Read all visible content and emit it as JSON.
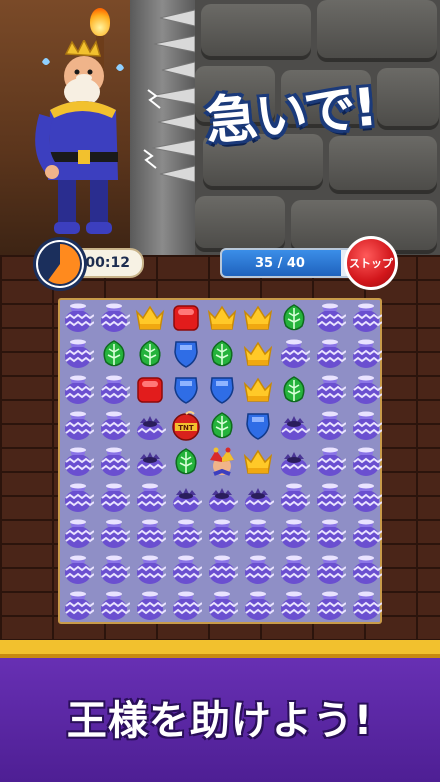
{
  "scene": {
    "headline": "急いで!"
  },
  "hud": {
    "timer": "00:12",
    "timer_fraction_remaining": 0.6,
    "progress_text": "35 / 40",
    "progress_current": 35,
    "progress_total": 40,
    "stop_label": "ストップ"
  },
  "board": {
    "cols": 9,
    "rows": 9,
    "legend": {
      "P": "purple-pot",
      "C": "gold-crown",
      "R": "red-gem",
      "L": "green-leaf",
      "S": "blue-shield",
      "B": "broken-pot",
      "T": "tnt-booster",
      "K": "jester-booster"
    },
    "grid": [
      [
        "P",
        "P",
        "C",
        "R",
        "C",
        "C",
        "L",
        "P",
        "P"
      ],
      [
        "P",
        "L",
        "L",
        "S",
        "L",
        "C",
        "P",
        "P",
        "P"
      ],
      [
        "P",
        "P",
        "R",
        "S",
        "S",
        "C",
        "L",
        "P",
        "P"
      ],
      [
        "P",
        "P",
        "B",
        "T",
        "L",
        "S",
        "B",
        "P",
        "P"
      ],
      [
        "P",
        "P",
        "B",
        "L",
        "K",
        "C",
        "B",
        "P",
        "P"
      ],
      [
        "P",
        "P",
        "P",
        "B",
        "B",
        "B",
        "P",
        "P",
        "P"
      ],
      [
        "P",
        "P",
        "P",
        "P",
        "P",
        "P",
        "P",
        "P",
        "P"
      ],
      [
        "P",
        "P",
        "P",
        "P",
        "P",
        "P",
        "P",
        "P",
        "P"
      ],
      [
        "P",
        "P",
        "P",
        "P",
        "P",
        "P",
        "P",
        "P",
        "P"
      ]
    ]
  },
  "banner": {
    "title": "王様を助けよう!"
  },
  "colors": {
    "board_bg": "#8f8fc6",
    "banner_purple": "#5a28a6",
    "banner_gold": "#f2c12e",
    "stop_red": "#d2161b",
    "progress_blue": "#2a76d6"
  }
}
